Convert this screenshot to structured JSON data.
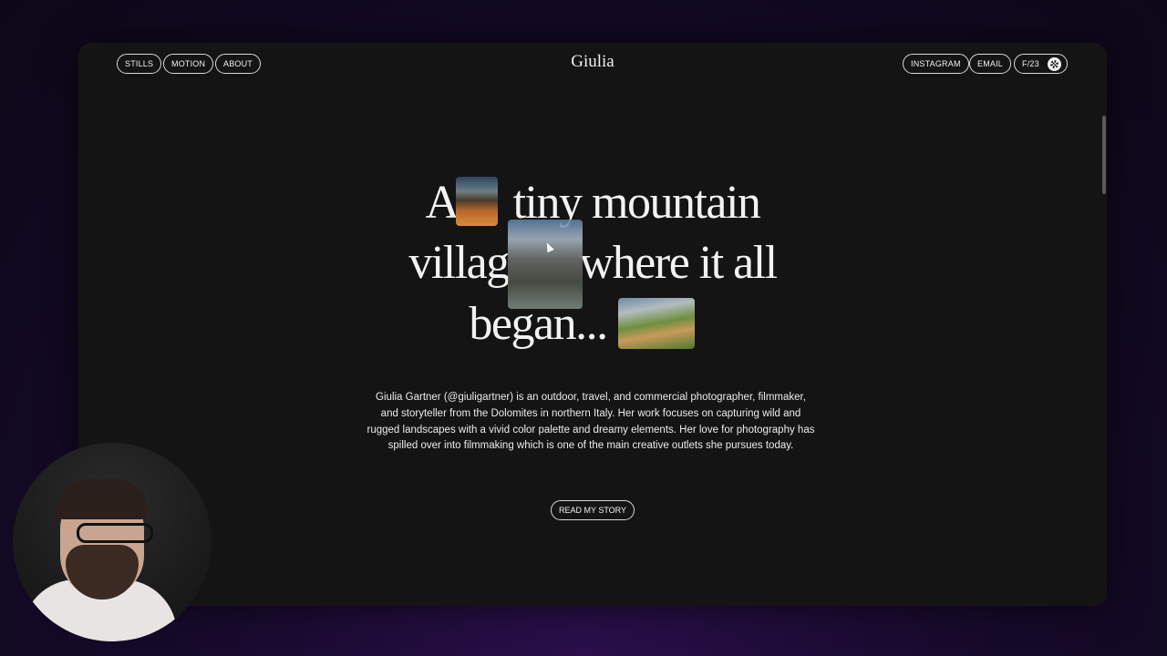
{
  "nav": {
    "left": [
      "STILLS",
      "MOTION",
      "ABOUT"
    ],
    "brand": "Giulia",
    "right": [
      "INSTAGRAM",
      "EMAIL"
    ],
    "frame_counter": "F/23"
  },
  "hero": {
    "line1_a": "A",
    "line1_b": "tiny mountain",
    "line2_a": "villag",
    "line2_b": "where it all",
    "line3": "began...",
    "images": [
      "mountain-sunset-photo",
      "dolomite-peaks-photo",
      "woman-lying-in-grass-photo"
    ]
  },
  "bio": {
    "text": "Giulia Gartner (@giuligartner) is an outdoor, travel, and commercial photographer, filmmaker, and storyteller from the Dolomites in northern Italy. Her work focuses on capturing wild and rugged landscapes with a vivid color palette and dreamy elements. Her love for photography has spilled over into filmmaking which is one of the main creative outlets she pursues today."
  },
  "cta": {
    "label": "READ MY STORY"
  },
  "colors": {
    "page_background": "#141414",
    "text": "#f2f2f2",
    "outer_background": "#170a2c"
  }
}
